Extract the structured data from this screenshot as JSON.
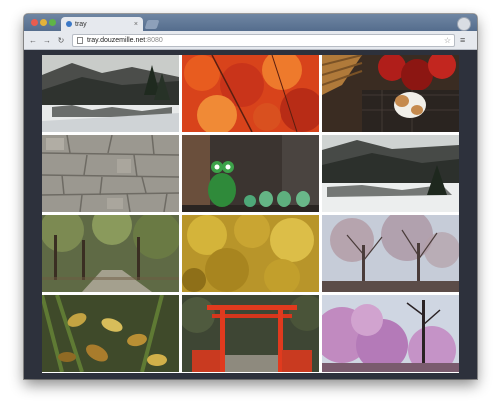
{
  "window": {
    "tab_title": "tray",
    "tab_close": "×",
    "url_host": "tray.douzemille.net",
    "url_port": ":8080",
    "back": "←",
    "forward": "→",
    "reload": "↻",
    "star": "☆",
    "menu": "≡"
  },
  "photos": [
    {
      "name": "snowy-village-valley"
    },
    {
      "name": "red-autumn-maple"
    },
    {
      "name": "cat-red-leaves"
    },
    {
      "name": "stone-wall"
    },
    {
      "name": "frog-figurines"
    },
    {
      "name": "snowy-village-valley-2"
    },
    {
      "name": "forest-path"
    },
    {
      "name": "yellow-ginkgo"
    },
    {
      "name": "bare-trees-sky"
    },
    {
      "name": "fallen-leaves"
    },
    {
      "name": "red-torii-gate"
    },
    {
      "name": "pink-weeping-cherry"
    }
  ]
}
